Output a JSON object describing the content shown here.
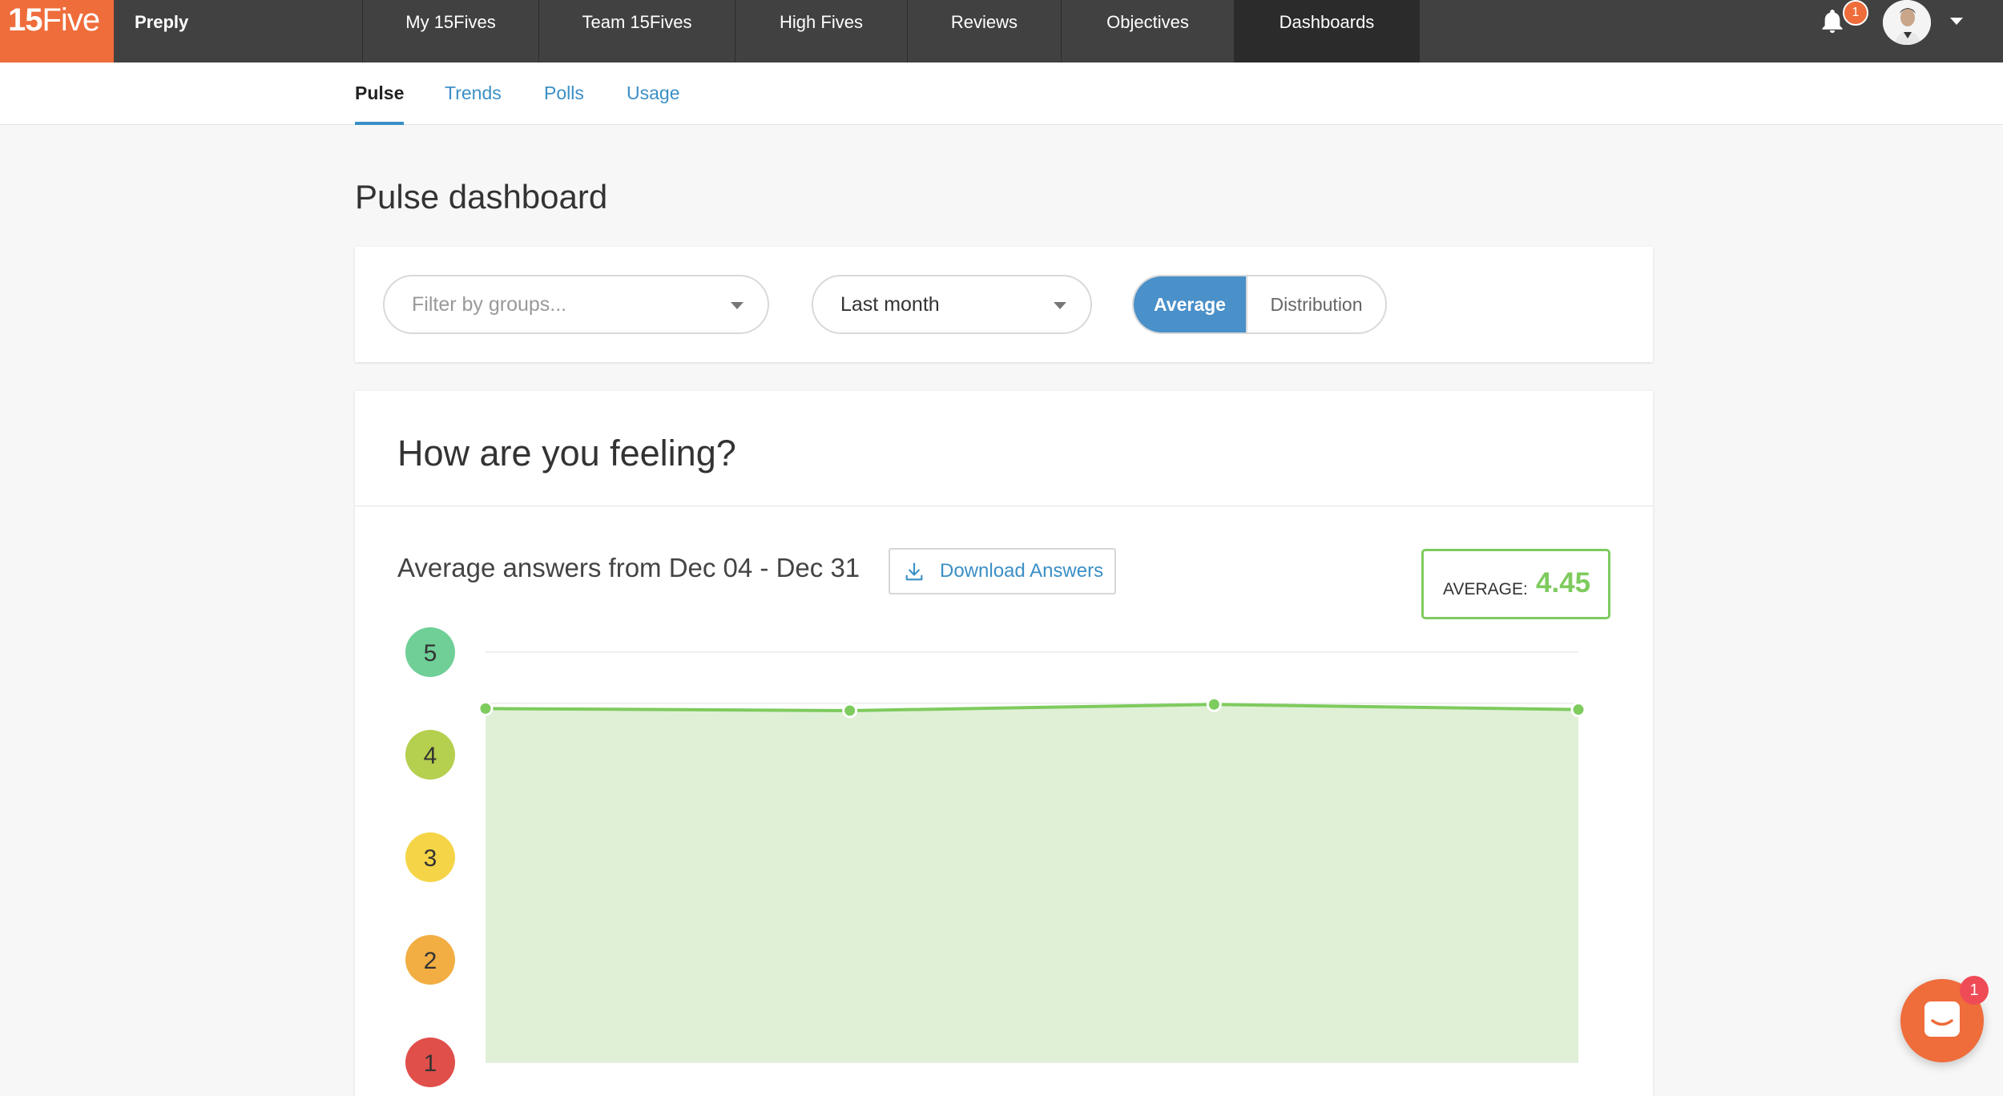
{
  "topbar": {
    "logo_bold": "15",
    "logo_light": "Five",
    "company": "Preply",
    "tabs": [
      {
        "label": "My 15Fives"
      },
      {
        "label": "Team 15Fives"
      },
      {
        "label": "High Fives"
      },
      {
        "label": "Reviews"
      },
      {
        "label": "Objectives"
      },
      {
        "label": "Dashboards",
        "active": true
      }
    ],
    "notification_count": "1"
  },
  "subnav": {
    "tabs": [
      {
        "label": "Pulse",
        "active": true
      },
      {
        "label": "Trends"
      },
      {
        "label": "Polls"
      },
      {
        "label": "Usage"
      }
    ]
  },
  "page": {
    "title": "Pulse dashboard"
  },
  "filters": {
    "groups_placeholder": "Filter by groups...",
    "period_value": "Last month",
    "view_options": [
      "Average",
      "Distribution"
    ],
    "view_selected": "Average"
  },
  "card": {
    "title": "How are you feeling?",
    "range_label": "Average answers from Dec 04 - Dec 31",
    "download_label": "Download Answers",
    "average_label": "AVERAGE:",
    "average_value": "4.45"
  },
  "chat": {
    "badge": "1"
  },
  "chart_data": {
    "type": "area",
    "title": "",
    "xlabel": "",
    "ylabel": "",
    "ylim": [
      1,
      5
    ],
    "y_ticks": [
      {
        "value": 5,
        "label": "5",
        "color": "#6fcf97"
      },
      {
        "value": 4,
        "label": "4",
        "color": "#b5cf4e"
      },
      {
        "value": 3,
        "label": "3",
        "color": "#f5d547"
      },
      {
        "value": 2,
        "label": "2",
        "color": "#f2ae43"
      },
      {
        "value": 1,
        "label": "1",
        "color": "#e04f4a"
      }
    ],
    "series": [
      {
        "values": [
          4.45,
          4.43,
          4.49,
          4.44
        ],
        "color": "#7ecb5e",
        "fill": "#e0f0d6"
      }
    ],
    "grid": true
  }
}
